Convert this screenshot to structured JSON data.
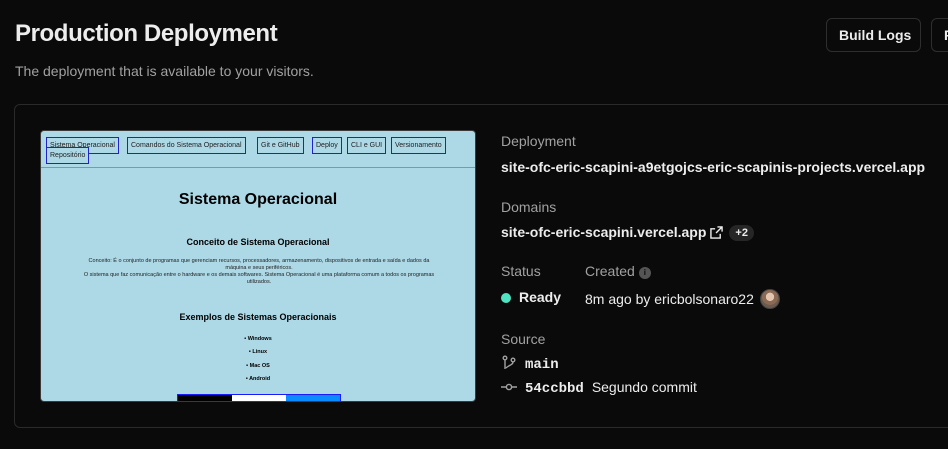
{
  "header": {
    "title": "Production Deployment",
    "subtitle": "The deployment that is available to your visitors.",
    "build_logs_label": "Build Logs",
    "cut_button_label": "R"
  },
  "preview": {
    "nav_links": [
      "Sistema Operacional",
      "Comandos do Sistema Operacional",
      "Git e GitHub",
      "Deploy",
      "CLI e GUI",
      "Versionamento",
      "Repositório"
    ],
    "title": "Sistema Operacional",
    "section1_heading": "Conceito de Sistema Operacional",
    "section1_line1": "Conceito: É o conjunto de programas que gerenciam recursos, processadores, armazenamento, dispositivos de entrada e saída e dados da",
    "section1_line2": "máquina e seus periféricos.",
    "section1_line3": "O sistema que faz comunicação entre o hardware e os demais softwares. Sistema Operacional é uma plataforma comum a todos os programas",
    "section1_line4": "utilizados.",
    "section2_heading": "Exemplos de Sistemas Operacionais",
    "list_items": [
      "Windows",
      "Linux",
      "Mac OS",
      "Android"
    ]
  },
  "deployment": {
    "label": "Deployment",
    "url": "site-ofc-eric-scapini-a9etgojcs-eric-scapinis-projects.vercel.app"
  },
  "domains": {
    "label": "Domains",
    "primary": "site-ofc-eric-scapini.vercel.app",
    "extra_count": "+2"
  },
  "status": {
    "label": "Status",
    "value": "Ready",
    "color": "#50e3c2"
  },
  "created": {
    "label": "Created",
    "info_icon": "i",
    "value": "8m ago by ericbolsonaro22"
  },
  "source": {
    "label": "Source",
    "branch": "main",
    "commit_hash": "54ccbbd",
    "commit_message": "Segundo commit"
  }
}
